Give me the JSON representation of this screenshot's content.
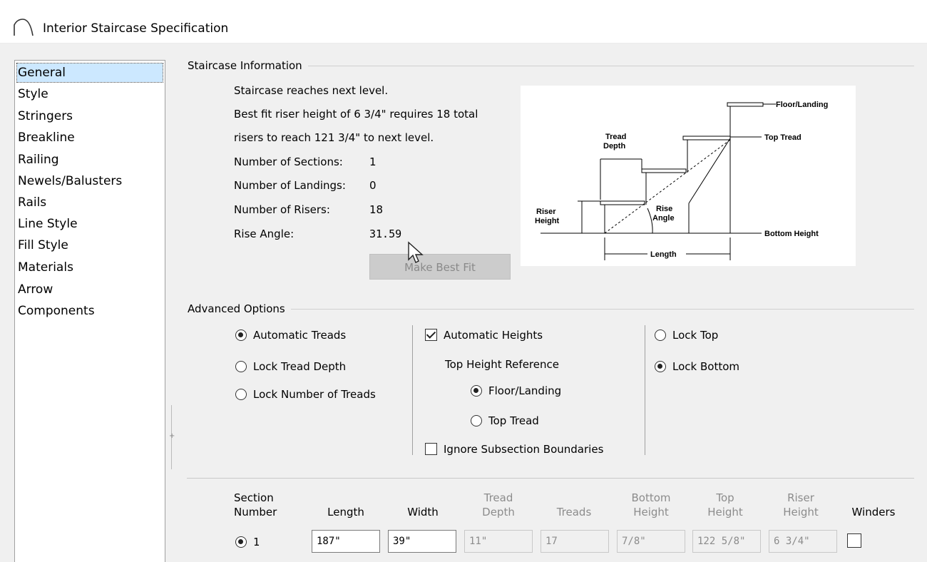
{
  "window": {
    "title": "Interior Staircase Specification"
  },
  "nav": {
    "items": [
      {
        "label": "General",
        "selected": true
      },
      {
        "label": "Style"
      },
      {
        "label": "Stringers"
      },
      {
        "label": "Breakline"
      },
      {
        "label": "Railing"
      },
      {
        "label": "Newels/Balusters"
      },
      {
        "label": "Rails"
      },
      {
        "label": "Line Style"
      },
      {
        "label": "Fill Style"
      },
      {
        "label": "Materials"
      },
      {
        "label": "Arrow"
      },
      {
        "label": "Components"
      }
    ]
  },
  "info": {
    "group_label": "Staircase Information",
    "line1": "Staircase reaches next level.",
    "line2": "Best fit riser height of 6 3/4\" requires 18 total",
    "line3": "risers to reach 121 3/4\" to next level.",
    "sections_label": "Number of Sections:",
    "sections_value": "1",
    "landings_label": "Number of Landings:",
    "landings_value": "0",
    "risers_label": "Number of Risers:",
    "risers_value": "18",
    "angle_label": "Rise Angle:",
    "angle_value": "31.59",
    "best_fit_button": "Make Best Fit"
  },
  "diagram": {
    "floor_landing": "Floor/Landing",
    "top_tread": "Top Tread",
    "tread": "Tread",
    "depth": "Depth",
    "riser": "Riser",
    "height": "Height",
    "rise": "Rise",
    "angle": "Angle",
    "bottom_height": "Bottom Height",
    "length": "Length"
  },
  "advanced": {
    "group_label": "Advanced Options",
    "automatic_treads": "Automatic Treads",
    "lock_tread_depth": "Lock Tread Depth",
    "lock_number_of_treads": "Lock Number of Treads",
    "automatic_heights": "Automatic Heights",
    "top_height_reference": "Top Height Reference",
    "floor_landing": "Floor/Landing",
    "top_tread": "Top Tread",
    "ignore_subsection": "Ignore Subsection Boundaries",
    "lock_top": "Lock Top",
    "lock_bottom": "Lock Bottom"
  },
  "table": {
    "headers": {
      "section1": "Section",
      "section2": "Number",
      "length": "Length",
      "width": "Width",
      "tread1": "Tread",
      "tread2": "Depth",
      "treads": "Treads",
      "bottom1": "Bottom",
      "bottom2": "Height",
      "top1": "Top",
      "top2": "Height",
      "riser1": "Riser",
      "riser2": "Height",
      "winders": "Winders"
    },
    "row": {
      "section": "1",
      "length": "187\"",
      "width": "39\"",
      "tread_depth": "11\"",
      "treads": "17",
      "bottom_height": "7/8\"",
      "top_height": "122 5/8\"",
      "riser_height": "6 3/4\""
    }
  }
}
